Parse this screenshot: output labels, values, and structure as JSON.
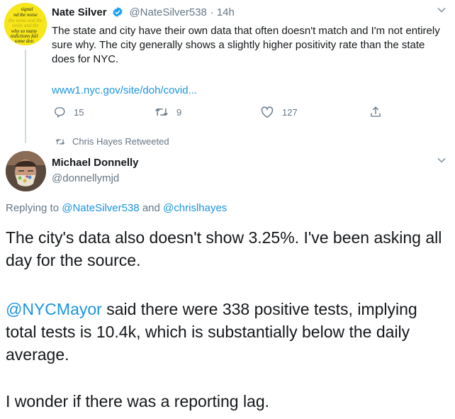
{
  "tweet1": {
    "avatar_text": [
      "signal",
      "nd the noise",
      "the noise and the",
      "noise and the",
      "why so many",
      "redictions fail",
      "some don"
    ],
    "display_name": "Nate Silver",
    "handle": "@NateSilver538",
    "separator": "·",
    "time": "14h",
    "text": "The state and city have their own data that often doesn't match and I'm not entirely sure why. The city generally shows a slightly higher positivity rate than the state does for NYC.",
    "link": "www1.nyc.gov/site/doh/covid...",
    "reply_count": "15",
    "retweet_count": "9",
    "like_count": "127"
  },
  "retweet_banner": "Chris Hayes Retweeted",
  "tweet2": {
    "display_name": "Michael Donnelly",
    "handle": "@donnellymjd",
    "replying_prefix": "Replying to",
    "replying_user1": "@NateSilver538",
    "replying_and": "and",
    "replying_user2": "@chrislhayes",
    "para1": "The city's data also doesn't show 3.25%. I've been asking all day for the source.",
    "mention": "@NYCMayor",
    "para2_rest": " said there were 338 positive tests, implying total tests is 10.4k, which is substantially below the daily average.",
    "para3": "I wonder if there was a reporting lag."
  },
  "colors": {
    "link": "#1b95e0",
    "verified": "#1da1f2",
    "muted": "#657786",
    "avatar1_bg": "#f6e61a"
  },
  "icons": [
    "verified-icon",
    "chevron-down-icon",
    "reply-icon",
    "retweet-icon",
    "like-icon",
    "share-icon"
  ]
}
